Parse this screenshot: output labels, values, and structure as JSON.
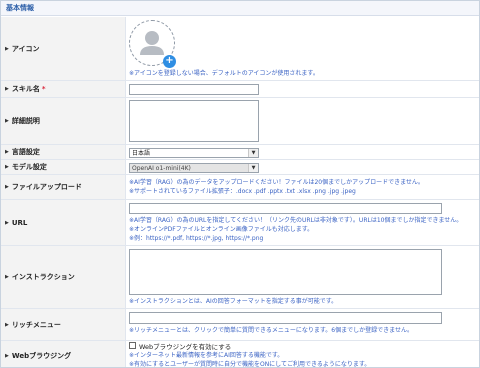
{
  "section": {
    "title": "基本情報"
  },
  "fields": {
    "icon": {
      "label": "アイコン",
      "note": "※アイコンを登録しない場合、デフォルトのアイコンが使用されます。"
    },
    "skill_name": {
      "label": "スキル名",
      "required_mark": "*",
      "value": ""
    },
    "description": {
      "label": "詳細説明",
      "value": ""
    },
    "language": {
      "label": "言語設定",
      "selected": "日本語"
    },
    "model": {
      "label": "モデル設定",
      "selected": "OpenAI o1-mini(4K)"
    },
    "file_upload": {
      "label": "ファイルアップロード",
      "note1": "※AI学習（RAG）の為のデータをアップロードください！ファイルは20個までしかアップロードできません。",
      "note2": "※サポートされているファイル拡張子：.docx .pdf .pptx .txt .xlsx .png .jpg .jpeg"
    },
    "url": {
      "label": "URL",
      "value": "",
      "note1": "※AI学習（RAG）の為のURLを指定してください！（リンク先のURLは非対象です）。URLは10個までしか指定できません。",
      "note2": "※オンラインPDFファイルとオンライン画像ファイルも対応します。",
      "note3": "※例：https://*.pdf, https://*.jpg, https://*.png"
    },
    "instruction": {
      "label": "インストラクション",
      "value": "",
      "note": "※インストラクションとは、AIの回答フォーマットを指定する事が可能です。"
    },
    "rich_menu": {
      "label": "リッチメニュー",
      "value": "",
      "note": "※リッチメニューとは、クリックで簡単に質問できるメニューになります。6個までしか登録できません。"
    },
    "web_browsing": {
      "label": "Webブラウジング",
      "checkbox_label": "Webブラウジングを有効にする",
      "checked": false,
      "note1": "※インターネット最新情報を参考にAI回答する機能です。",
      "note2": "※有効にするとユーザーが質問時に自分で機能をONにしてご利用できるようになります。"
    }
  }
}
